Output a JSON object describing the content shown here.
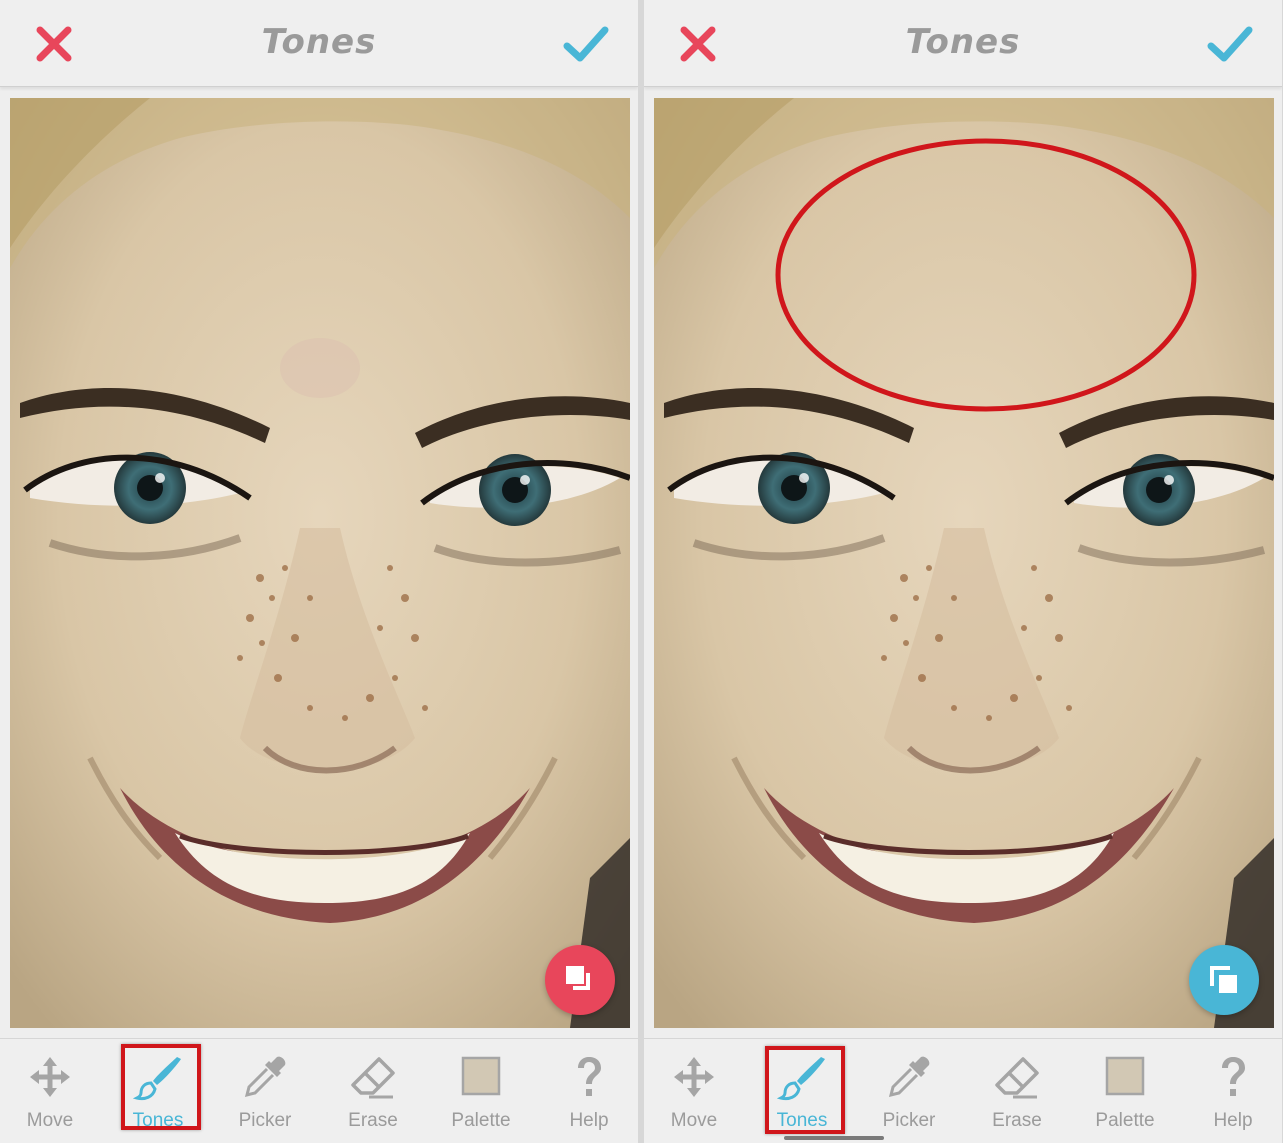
{
  "screen_title": "Tones",
  "colors": {
    "accent": "#49b6d6",
    "cancel": "#e8465b",
    "highlight": "#d0161b",
    "inactive": "#9b9b9b",
    "fab_left": "#e8465b",
    "fab_right": "#49b6d6",
    "palette_swatch": "#d2c8b4"
  },
  "panels": [
    {
      "title": "Tones",
      "cancel_icon": "close-x-icon",
      "confirm_icon": "checkmark-icon",
      "fab_icon": "compare-layers-icon",
      "fab_color": "#e8465b",
      "forehead_annotation": false,
      "toolbar": [
        {
          "label": "Move",
          "icon": "move-arrows-icon",
          "active": false
        },
        {
          "label": "Tones",
          "icon": "brush-icon",
          "active": true
        },
        {
          "label": "Picker",
          "icon": "eyedropper-icon",
          "active": false
        },
        {
          "label": "Erase",
          "icon": "eraser-icon",
          "active": false
        },
        {
          "label": "Palette",
          "icon": "palette-swatch-icon",
          "active": false
        },
        {
          "label": "Help",
          "icon": "question-icon",
          "active": false
        }
      ]
    },
    {
      "title": "Tones",
      "cancel_icon": "close-x-icon",
      "confirm_icon": "checkmark-icon",
      "fab_icon": "compare-layers-icon",
      "fab_color": "#49b6d6",
      "forehead_annotation": true,
      "toolbar": [
        {
          "label": "Move",
          "icon": "move-arrows-icon",
          "active": false
        },
        {
          "label": "Tones",
          "icon": "brush-icon",
          "active": true
        },
        {
          "label": "Picker",
          "icon": "eyedropper-icon",
          "active": false
        },
        {
          "label": "Erase",
          "icon": "eraser-icon",
          "active": false
        },
        {
          "label": "Palette",
          "icon": "palette-swatch-icon",
          "active": false
        },
        {
          "label": "Help",
          "icon": "question-icon",
          "active": false
        }
      ]
    }
  ]
}
